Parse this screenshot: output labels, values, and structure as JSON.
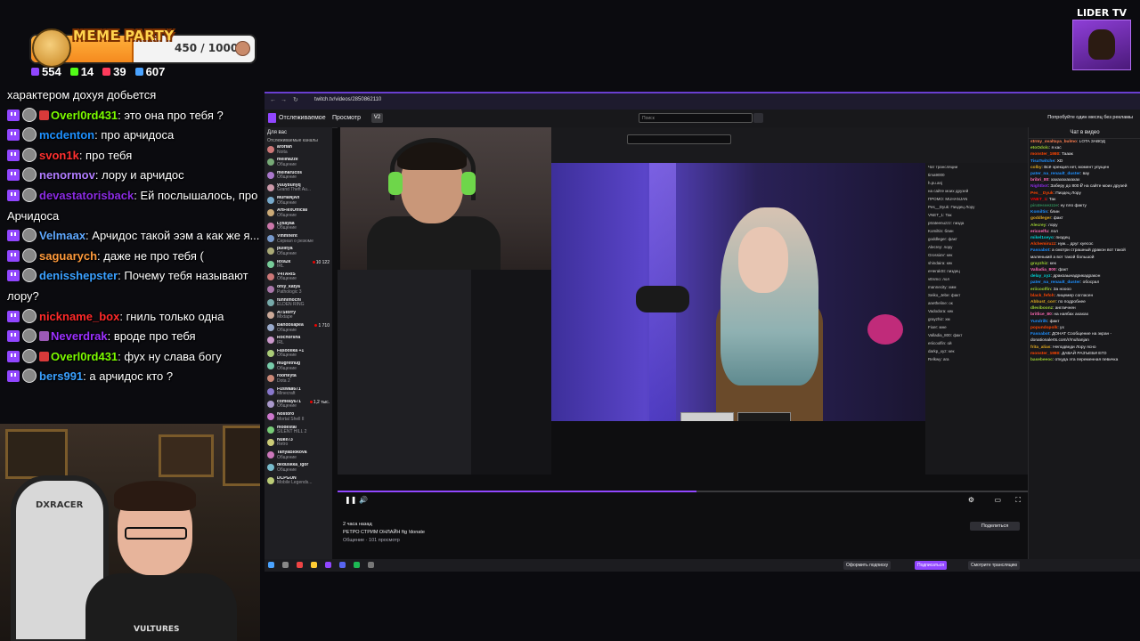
{
  "meme": {
    "title": "MEME PARTY",
    "progress_text": "450 / 1000",
    "progress_fraction": 0.45,
    "fill_color": "#f58a1f"
  },
  "stats": [
    {
      "icon": "chat-bubble-icon",
      "value": "554",
      "color": "#9146ff"
    },
    {
      "icon": "kick-icon",
      "value": "14",
      "color": "#53fc18"
    },
    {
      "icon": "vk-live-icon",
      "value": "39",
      "color": "#ff3b5c"
    },
    {
      "icon": "viewers-icon",
      "value": "607",
      "color": "#4aa3ff"
    }
  ],
  "overlay_chat": [
    {
      "nick": "",
      "nick_color": "#ffffff",
      "text": "характером дохуя добьется",
      "continuation": true
    },
    {
      "nick": "Overl0rd431",
      "nick_color": "#7cfc00",
      "text": "это она про тебя ?"
    },
    {
      "nick": "mcdenton",
      "nick_color": "#1e90ff",
      "text": "про арчидоса"
    },
    {
      "nick": "svon1k",
      "nick_color": "#ff3030",
      "text": "про тебя"
    },
    {
      "nick": "nenormov",
      "nick_color": "#b07cff",
      "text": "лору и арчидос"
    },
    {
      "nick": "devastatorisback",
      "nick_color": "#8a2be2",
      "text": "Ей послышалось, про Арчидоса"
    },
    {
      "nick": "Velmaax",
      "nick_color": "#5fa8ff",
      "text": "Арчидос такой ээм а как же я..."
    },
    {
      "nick": "saguarych",
      "nick_color": "#ff9a3c",
      "text": "даже не про тебя ("
    },
    {
      "nick": "denisshepster",
      "nick_color": "#3aa0ff",
      "text": "Почему тебя называют лору?"
    },
    {
      "nick": "nickname_box",
      "nick_color": "#ff2a2a",
      "text": "гниль только одна"
    },
    {
      "nick": "Neverdrak",
      "nick_color": "#9b30ff",
      "text": "вроде про тебя"
    },
    {
      "nick": "Overl0rd431",
      "nick_color": "#7cfc00",
      "text": "фух ну слава богу"
    },
    {
      "nick": "bers991",
      "nick_color": "#3aa0ff",
      "text": "а арчидос кто ?"
    }
  ],
  "lider": {
    "title": "LIDER TV"
  },
  "browser": {
    "url": "twitch.tv/videos/2850862110",
    "nav": {
      "following": "Отслеживаемое",
      "browse": "Просмотр",
      "search_placeholder": "Поиск",
      "promo": "Попробуйте один месяц без рекламы"
    },
    "sidebar": {
      "title": "Для вас",
      "subtitle": "Отслеживаемые каналы",
      "items": [
        {
          "name": "aroffah",
          "category": "Noita",
          "count": "",
          "color": "#c77"
        },
        {
          "name": "mellhazze",
          "category": "Общение",
          "count": "",
          "color": "#7a7"
        },
        {
          "name": "melharucos",
          "category": "Общение",
          "count": "",
          "color": "#a7c"
        },
        {
          "name": "yuuybunyq",
          "category": "Grand Theft Au...",
          "count": "",
          "color": "#c9a"
        },
        {
          "name": "MuHaNjAn",
          "category": "Общение",
          "count": "",
          "color": "#7ac"
        },
        {
          "name": "ArtFlexOfficial",
          "category": "Общение",
          "count": "",
          "color": "#ca7"
        },
        {
          "name": "Lysayaa",
          "category": "Общение",
          "count": "",
          "color": "#c7a"
        },
        {
          "name": "Vmmnent",
          "category": "Сериал о резюме",
          "count": "",
          "color": "#79c"
        },
        {
          "name": "pullitya",
          "category": "Общение",
          "count": "",
          "color": "#aa7"
        },
        {
          "name": "lexa2k",
          "category": "IRL",
          "count": "10 122",
          "color": "#7c9"
        },
        {
          "name": "V4TARIS",
          "category": "Общение",
          "count": "",
          "color": "#c77"
        },
        {
          "name": "only_katya",
          "category": "Pathologic 3",
          "count": "",
          "color": "#a7a"
        },
        {
          "name": "funnimochi",
          "category": "ELDEN RING",
          "count": "",
          "color": "#7aa"
        },
        {
          "name": "ATStorry",
          "category": "Mixtape",
          "count": "",
          "color": "#ca9"
        },
        {
          "name": "Bandosapea",
          "category": "Общение",
          "count": "1 710",
          "color": "#9ac"
        },
        {
          "name": "Rochorsha",
          "category": "IRL",
          "count": "",
          "color": "#c9c"
        },
        {
          "name": "Fasoollka +1",
          "category": "Общение",
          "count": "",
          "color": "#ac7"
        },
        {
          "name": "mugretnug",
          "category": "Общение",
          "count": "",
          "color": "#7ca"
        },
        {
          "name": "roorteyta",
          "category": "Dota 2",
          "count": "",
          "color": "#c87"
        },
        {
          "name": "Fuswaa671",
          "category": "Minecraft",
          "count": "",
          "color": "#87c"
        },
        {
          "name": "comeay671",
          "category": "Общение",
          "count": "1,2 тыс.",
          "color": "#a9c"
        },
        {
          "name": "Nostoro",
          "category": "Mortal Shell II",
          "count": "",
          "color": "#c7c"
        },
        {
          "name": "modestal",
          "category": "SILENT HILL 2",
          "count": "",
          "color": "#7c7"
        },
        {
          "name": "Nuke73",
          "category": "Retro",
          "count": "",
          "color": "#cc7"
        },
        {
          "name": "TanyaBlokova",
          "category": "Общение",
          "count": "",
          "color": "#c7b"
        },
        {
          "name": "deduskka_lgor",
          "category": "Общение",
          "count": "",
          "color": "#7bc"
        },
        {
          "name": "DCPGUN",
          "category": "Mobile Legends...",
          "count": "",
          "color": "#bc7"
        }
      ]
    },
    "nested_chat": [
      "Чат трансляции",
      "tima9000",
      "h.pu.anj",
      "на сайте моих друзей",
      "ПРОМО: MUHANJAN",
      "Pes__Dyuk: Пиздец Лору",
      "VNET_1: Так",
      "ptrateenuzzz: пизда",
      "Komiltin: блин",
      "goddleger: факт",
      "Alecrey: лору",
      "GrossiaV: кек",
      "shindaira: кек",
      "eHerakSt: пиздец",
      "vEsmo: лол",
      "mannecity: хмм",
      "Seiko_Jebe: факт",
      "anetheline: ок",
      "Vadodora: кек",
      "grayzhiz: хм",
      "Fixer: мне",
      "Valladia_800: факт",
      "eriicoolfin: ой",
      "darkp_xyz: кек",
      "Relkwy: ага"
    ],
    "video_info": {
      "time_ago": "2 часа назад",
      "title": "РЕТРО СТРИМ ОНЛАЙН ftg !donate",
      "meta": "Общение · 101 просмотр",
      "share": "Поделиться"
    },
    "right_chat": {
      "title": "Чат в видео",
      "messages": [
        {
          "nick": "strmy_ovaltaya_bulmo",
          "text": "LOTA ЗАВОД",
          "color": "#ff7f50"
        },
        {
          "nick": "etoOdolc",
          "text": "я кас",
          "color": "#9acd32"
        },
        {
          "nick": "monster_1980",
          "text": "Тааак",
          "color": "#ff4500"
        },
        {
          "nick": "TisaTwitche",
          "text": "XD",
          "color": "#1e90ff"
        },
        {
          "nick": "colby",
          "text": "Всё эрекция нет, момент упущен",
          "color": "#daa520"
        },
        {
          "nick": "pater_na_renault_duster",
          "text": "вау",
          "color": "#1e90ff"
        },
        {
          "nick": "bribri_80",
          "text": "хахахахахахах",
          "color": "#ff69b4"
        },
        {
          "nick": "Nightbot",
          "text": "Заберу до 800 ₽ на сайте моих друзей",
          "color": "#8a2be2"
        },
        {
          "nick": "Pes__Dyuk",
          "text": "Пиздец Лору",
          "color": "#ff4500"
        },
        {
          "nick": "VNET_1",
          "text": "Так",
          "color": "#ff0000"
        },
        {
          "nick": "piratessezzze",
          "text": "ну пло факту",
          "color": "#2e8b57"
        },
        {
          "nick": "Komiltin",
          "text": "блин",
          "color": "#1e90ff"
        },
        {
          "nick": "goddleger",
          "text": "факт",
          "color": "#daa520"
        },
        {
          "nick": "Alecrey",
          "text": "лору",
          "color": "#9acd32"
        },
        {
          "nick": "ericoelfu",
          "text": "лол",
          "color": "#ff69b4"
        },
        {
          "nick": "mikel1seyo",
          "text": "пиздец",
          "color": "#00ced1"
        },
        {
          "nick": "Alchemiruzz",
          "text": "нуж... друг хуесос",
          "color": "#ff4500"
        },
        {
          "nick": "Fasoabot",
          "text": "а смотри страшный дракон вот такой маленький а вот такой большой",
          "color": "#1e90ff"
        },
        {
          "nick": "grayzhiz",
          "text": "кек",
          "color": "#9acd32"
        },
        {
          "nick": "Valladia_800",
          "text": "факт",
          "color": "#ff69b4"
        },
        {
          "nick": "delay_xyz",
          "text": "дракоаынадрикадракон",
          "color": "#00ced1"
        },
        {
          "nick": "pater_na_renault_duster",
          "text": "обосрал",
          "color": "#1e90ff"
        },
        {
          "nick": "eriicoolfin",
          "text": "За ноооо",
          "color": "#9acd32"
        },
        {
          "nick": "black_fefoh",
          "text": "лицемер согласен",
          "color": "#ff4500"
        },
        {
          "nick": "Abbust_corr",
          "text": "по подробнее",
          "color": "#daa520"
        },
        {
          "nick": "dleviboonz",
          "text": "англичнен",
          "color": "#9acd32"
        },
        {
          "nick": "britlice_80",
          "text": "на наябах ахахах",
          "color": "#ff69b4"
        },
        {
          "nick": "Yundrilk",
          "text": "факт",
          "color": "#1e90ff"
        },
        {
          "nick": "popundopolk",
          "text": "ух",
          "color": "#ff4500"
        },
        {
          "nick": "Fasoabot",
          "text": "ДОНАТ Сообщение на экран - donationalerts.com/r/muhanjan",
          "color": "#1e90ff"
        },
        {
          "nick": "frita_alias",
          "text": "Неподведи Лору ясно",
          "color": "#daa520"
        },
        {
          "nick": "monster_1980",
          "text": "ДАВАЙ РАЗЪЕБИ ЕГО",
          "color": "#ff4500"
        },
        {
          "nick": "basebeeoc",
          "text": "откуда эта переменная певичка",
          "color": "#9acd32"
        }
      ]
    },
    "bottom": {
      "subscribe": "Подписаться",
      "follow": "Оформить подписку",
      "watch": "Смотрите трансляцию"
    }
  }
}
